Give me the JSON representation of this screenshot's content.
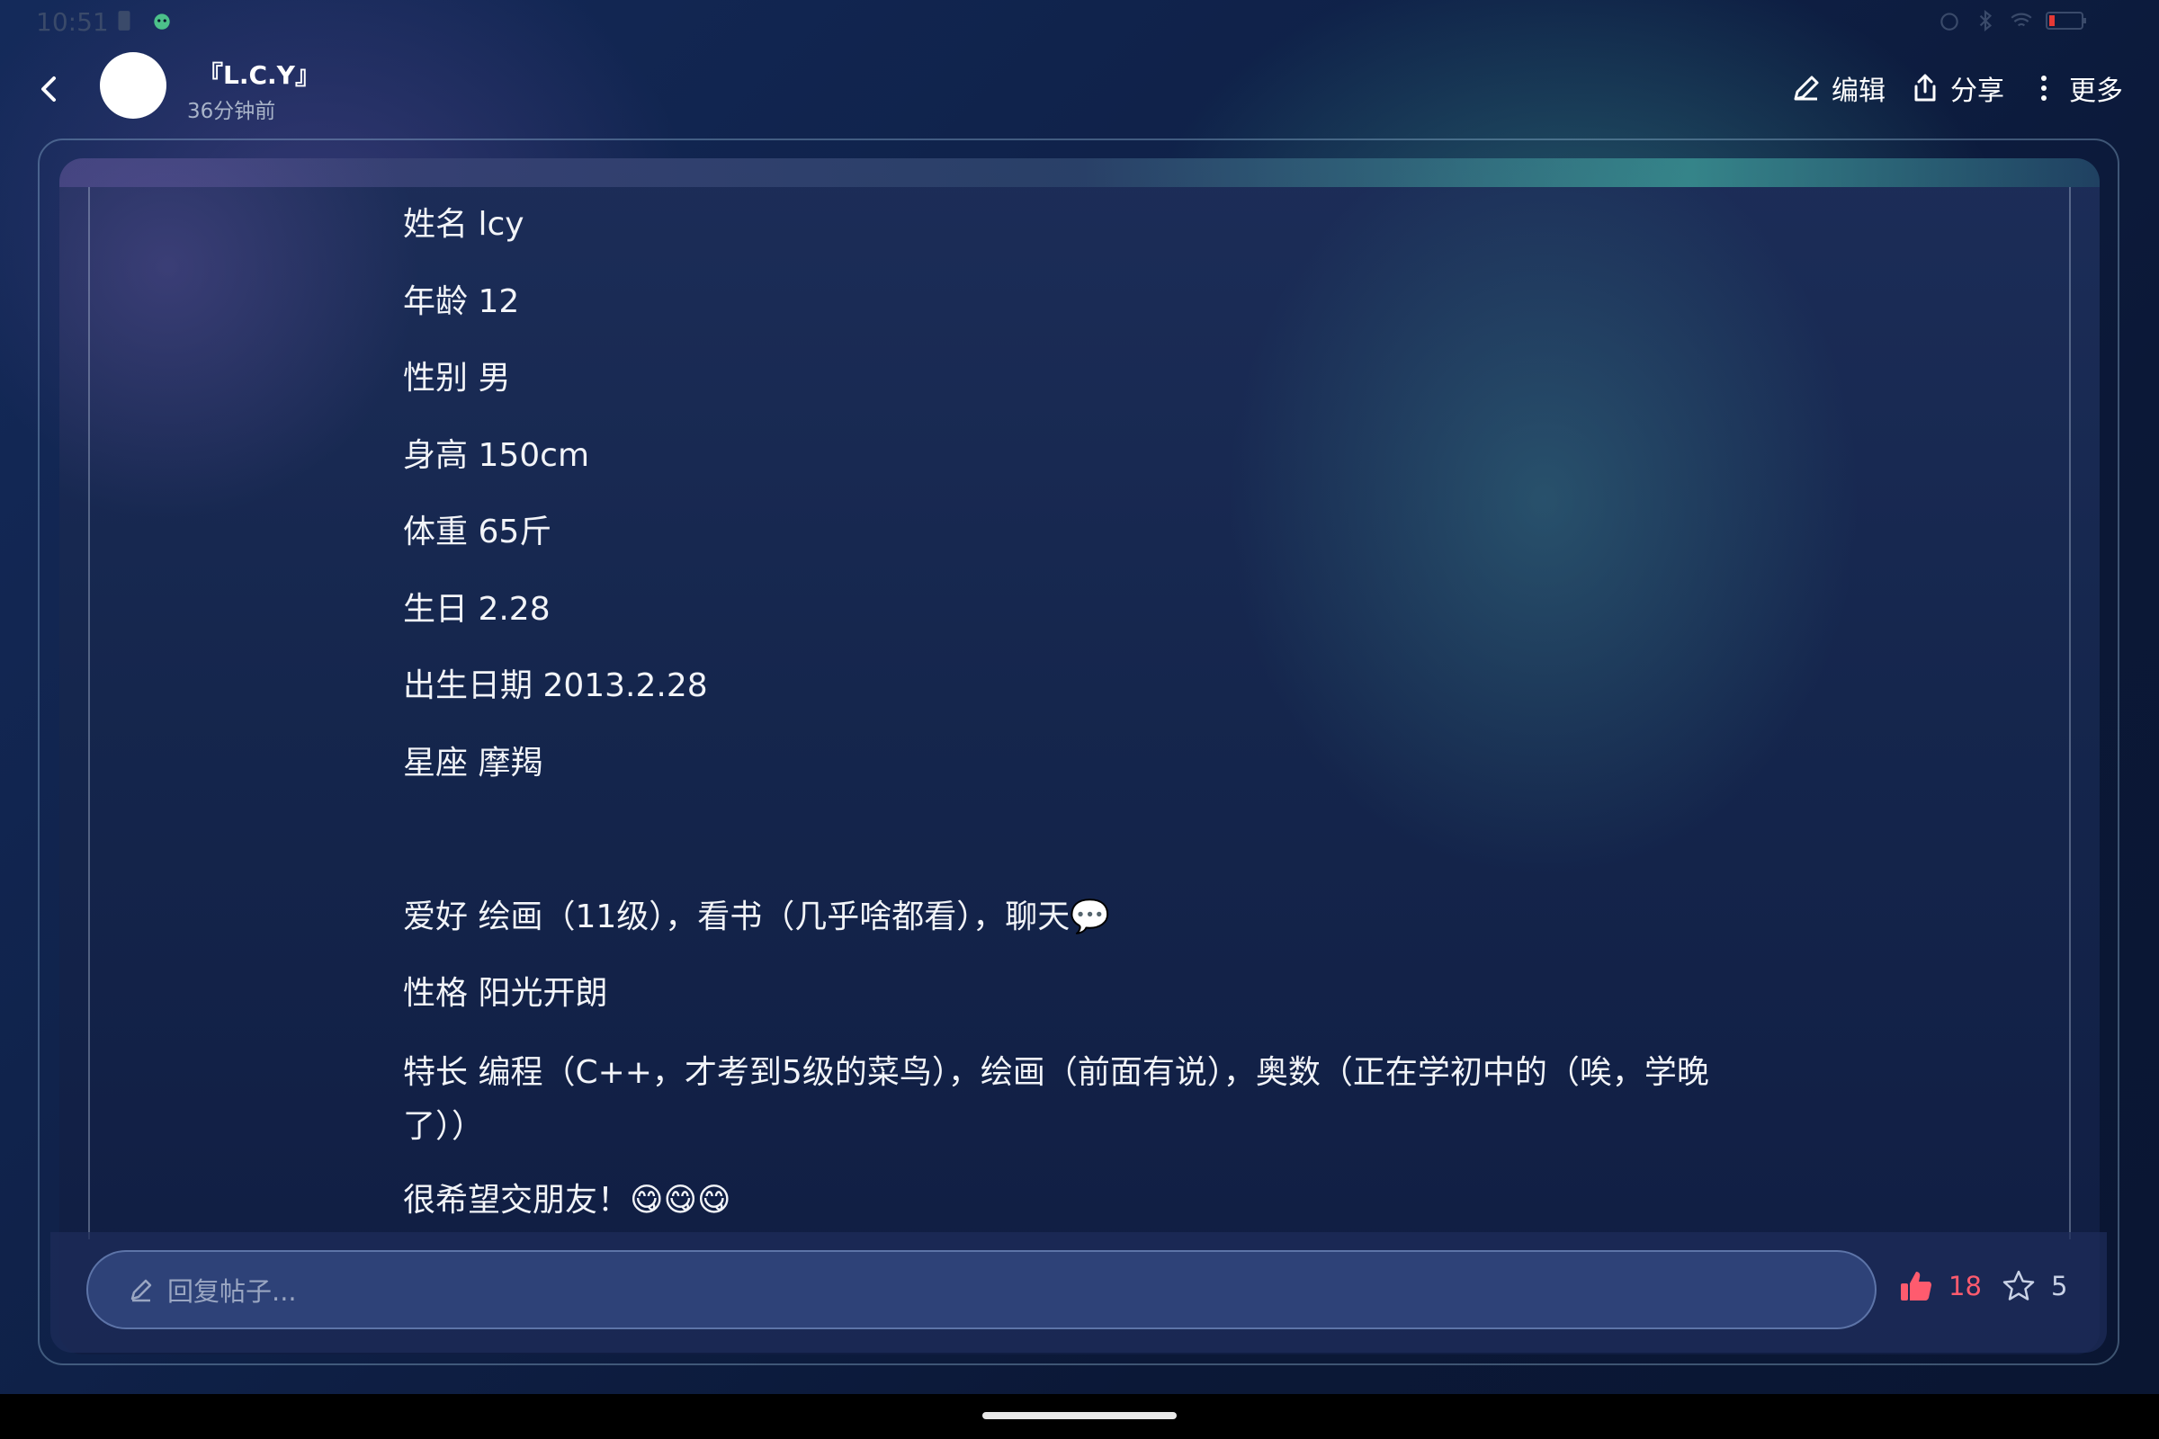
{
  "status_bar": {
    "time": "10:51"
  },
  "header": {
    "author": "『L.C.Y』",
    "post_time": "36分钟前",
    "actions": {
      "edit": "编辑",
      "share": "分享",
      "more": "更多"
    }
  },
  "post": {
    "lines": [
      "姓名 lcy",
      "年龄 12",
      "性别 男",
      "身高 150cm",
      "体重 65斤",
      "生日 2.28",
      "出生日期 2013.2.28",
      "星座 摩羯",
      "",
      "爱好 绘画（11级），看书（几乎啥都看），聊天💬",
      "性格 阳光开朗",
      "特长 编程（C++，才考到5级的菜鸟），绘画（前面有说），奥数（正在学初中的（唉，学晚了））",
      "很希望交朋友！😋😋😋"
    ]
  },
  "reply": {
    "placeholder": "回复帖子..."
  },
  "stats": {
    "likes": "18",
    "favorites": "5"
  },
  "colors": {
    "like": "#ff5b6e",
    "accent_teal": "#3fb8a8"
  }
}
